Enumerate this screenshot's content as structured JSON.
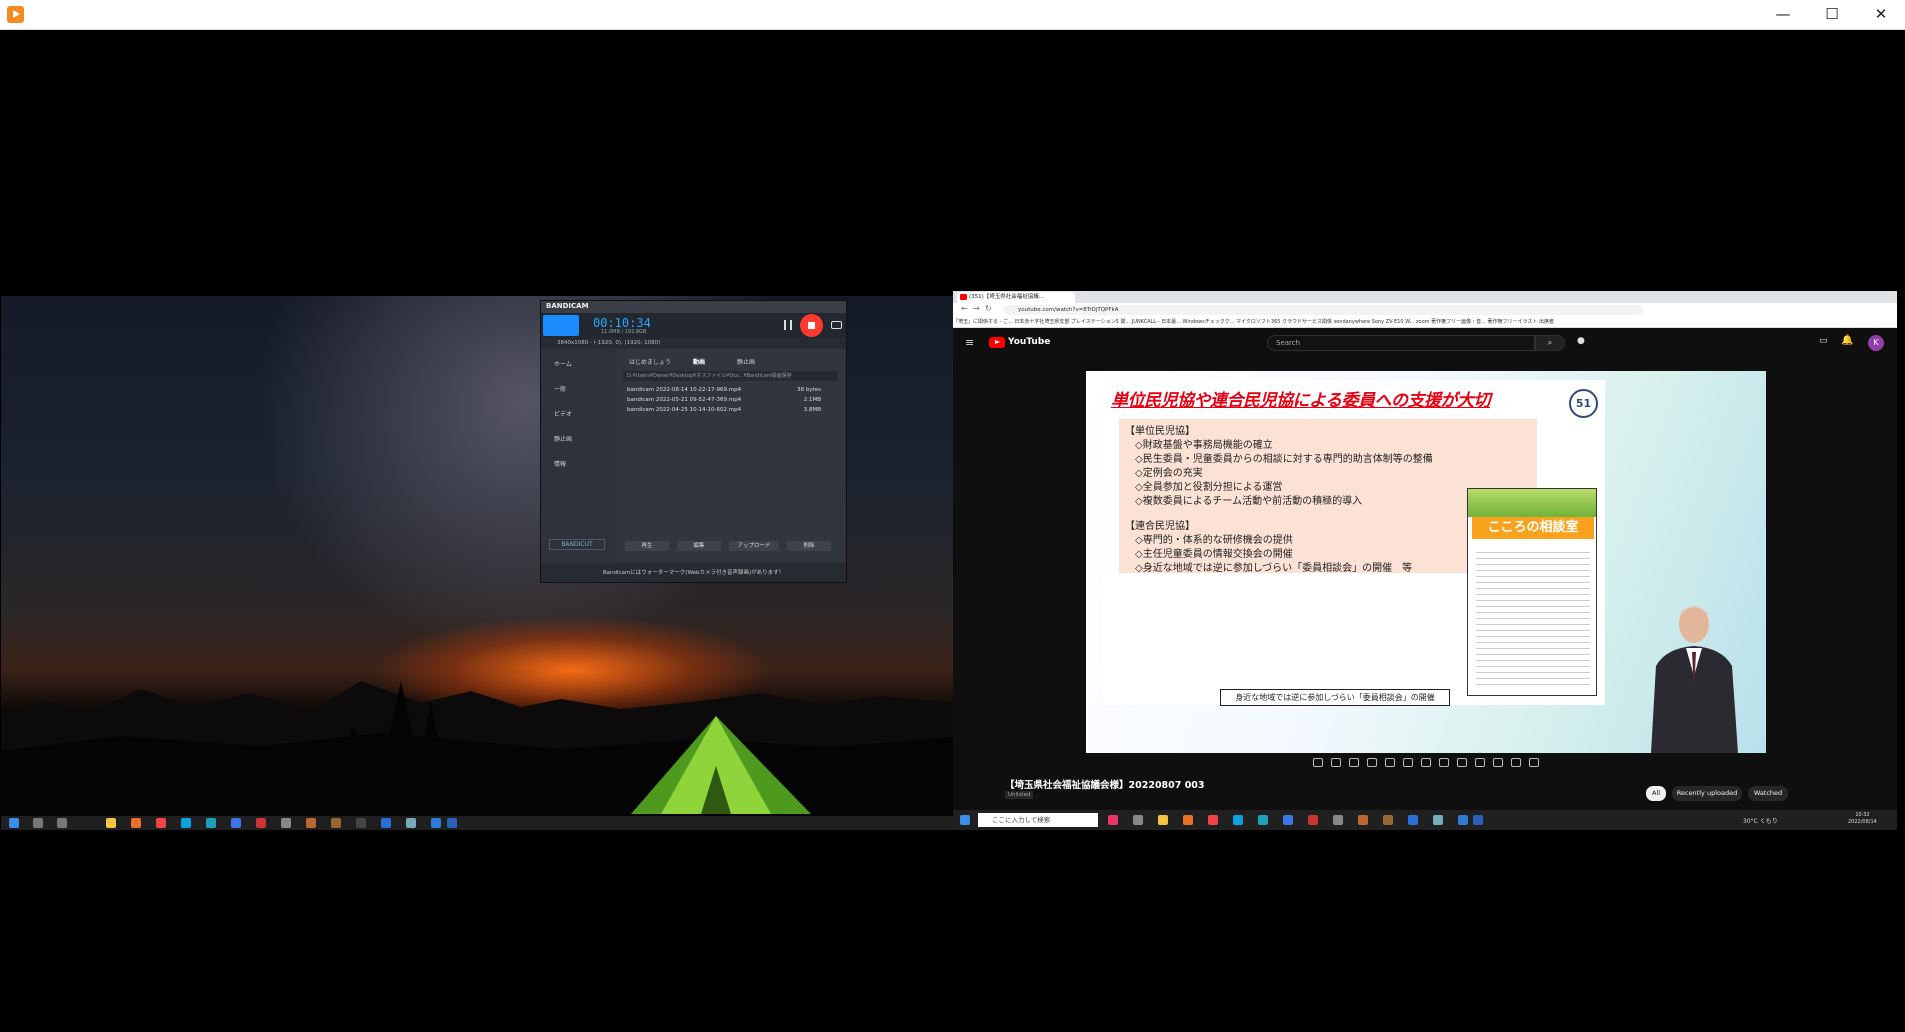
{
  "window": {
    "minimize_glyph": "—",
    "maximize_glyph": "☐",
    "close_glyph": "✕"
  },
  "bandicam": {
    "brand": "BANDICAM",
    "time": "00:10:34",
    "size": "11.0MB / 192.8GB",
    "resolution": "3840x1080 - (-1920, 0), (1920, 1080)",
    "nav": [
      "ホーム",
      "一般",
      "ビデオ",
      "静止画",
      "情報"
    ],
    "tabs": [
      "はじめましょう",
      "動画",
      "静止画"
    ],
    "path": "D:¥Users¥Owner¥Desktop¥オスファイル¥Ocs...¥Bandicam録画保存",
    "files": [
      {
        "name": "bandicam 2022-08-14 10-22-17-969.mp4",
        "size": "38 bytes"
      },
      {
        "name": "bandicam 2022-05-21 09-52-47-369.mp4",
        "size": "2.1MB"
      },
      {
        "name": "bandicam 2022-04-25 10-14-10-602.mp4",
        "size": "3.8MB"
      }
    ],
    "buttons": [
      "再生",
      "編集",
      "アップロード",
      "削除"
    ],
    "bandicut": "BANDICUT",
    "footer": "Bandicamにはウォーターマーク(Webカメラ付き音声録画)があります！"
  },
  "browser": {
    "tab_title": "(351)【埼玉県社会福祉協議...",
    "url": "youtube.com/watch?v=8TrDjTQPFkA",
    "bookmarks": "「埼玉」に関係する - ご...   日本赤十字社埼玉県支部   プレイステーション5 関...   JUNKCALL - 日本最...   Windowsチェックク...   マイクロソフト365   クラウドサービス関係   sendanywhere   Sony   ZV-E10   W...   zoom   著作権フリー画像・音...   著作権フリーイラスト   出席者"
  },
  "youtube": {
    "logo": "YouTube",
    "search_placeholder": "Search",
    "avatar": "K",
    "video_title": "【埼玉県社会福祉協議会様】20220807 003",
    "unlisted": "Unlisted",
    "chips": [
      "All",
      "Recently uploaded",
      "Watched"
    ]
  },
  "slide": {
    "title": "単位民児協や連合民児協による委員への支援が大切",
    "page": "51",
    "lines": [
      "【単位民児協】",
      "　◇財政基盤や事務局機能の確立",
      "　◇民生委員・児童委員からの相談に対する専門的助言体制等の整備",
      "　◇定例会の充実",
      "　◇全員参加と役割分担による運営",
      "　◇複数委員によるチーム活動や前活動の積極的導入",
      "【連合民児協】",
      "　◇専門的・体系的な研修機会の提供",
      "　◇主任児童委員の情報交換会の開催",
      "　◇身近な地域では逆に参加しづらい「委員相談会」の開催　等"
    ],
    "poster_title": "こころの相談室",
    "caption": "身近な地域では逆に参加しづらい「委員相談会」の開催"
  },
  "taskbar": {
    "search": "ここに入力して検索",
    "weather": "30°C くもり",
    "time": "10:32",
    "date": "2022/08/14"
  }
}
